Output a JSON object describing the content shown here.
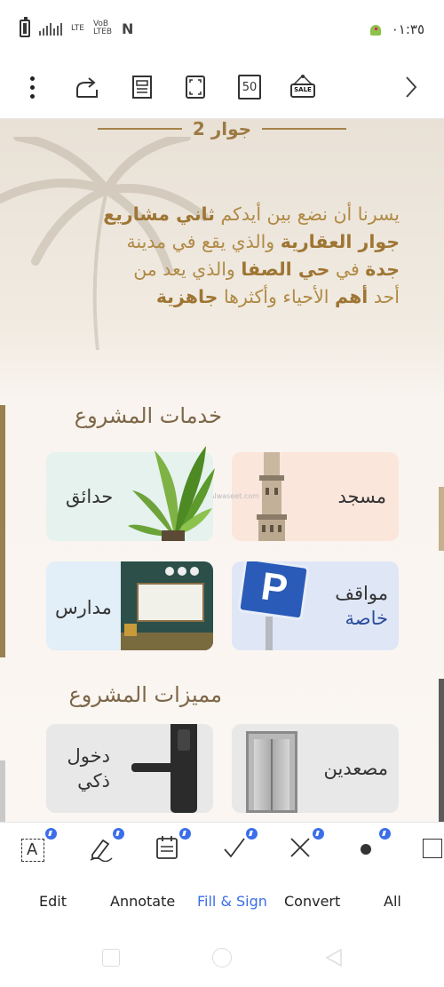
{
  "status_bar": {
    "signal_label_1": "LTE",
    "signal_label_2": "VoB LTEB",
    "nfc_icon": "N",
    "time": "٠١:٣٥"
  },
  "toolbar": {
    "icons": [
      "more-vertical-icon",
      "share-icon",
      "page-view-icon",
      "fullscreen-icon",
      "page-number",
      "sale-tag-icon",
      "next-icon"
    ],
    "page_number": "50",
    "sale_label": "SALE",
    "next_glyph": "›"
  },
  "document": {
    "title": "جوار 2",
    "intro": {
      "p1": "يسرنا أن نضع بين أيدكم ",
      "b1": "ثاني مشاريع",
      "b2": "جوار العقارية",
      "p2": " والذي يقع في مدينة",
      "b3": "جدة",
      "p3": " في ",
      "b4": "حي الصفا",
      "p4": " والذي يعد من",
      "p5": "أحد ",
      "b5": "أهم",
      "p6": " الأحياء وأكثرها ",
      "b6": "جاهزية"
    },
    "services_heading": "خدمات المشروع",
    "features_heading": "مميزات المشروع",
    "watermark": "Alwaseet.com",
    "cards": {
      "mosque": "مسجد",
      "gardens": "حدائق",
      "parking_1": "مواقف",
      "parking_2": "خاصة",
      "parking_sign": "P",
      "schools": "مدارس",
      "elevators": "مصعدين",
      "smart_1": "دخول",
      "smart_2": "ذكي"
    }
  },
  "tools": {
    "icons": [
      "text-box-icon",
      "signature-pen-icon",
      "form-icon",
      "checkmark-icon",
      "cross-icon",
      "dot-icon",
      "rectangle-icon"
    ],
    "text_tool_glyph": "A"
  },
  "tabs": {
    "edit": "Edit",
    "annotate": "Annotate",
    "fill_sign": "Fill & Sign",
    "convert": "Convert",
    "all": "All"
  },
  "colors": {
    "accent": "#3b6ee8",
    "gold": "#a5834a"
  }
}
